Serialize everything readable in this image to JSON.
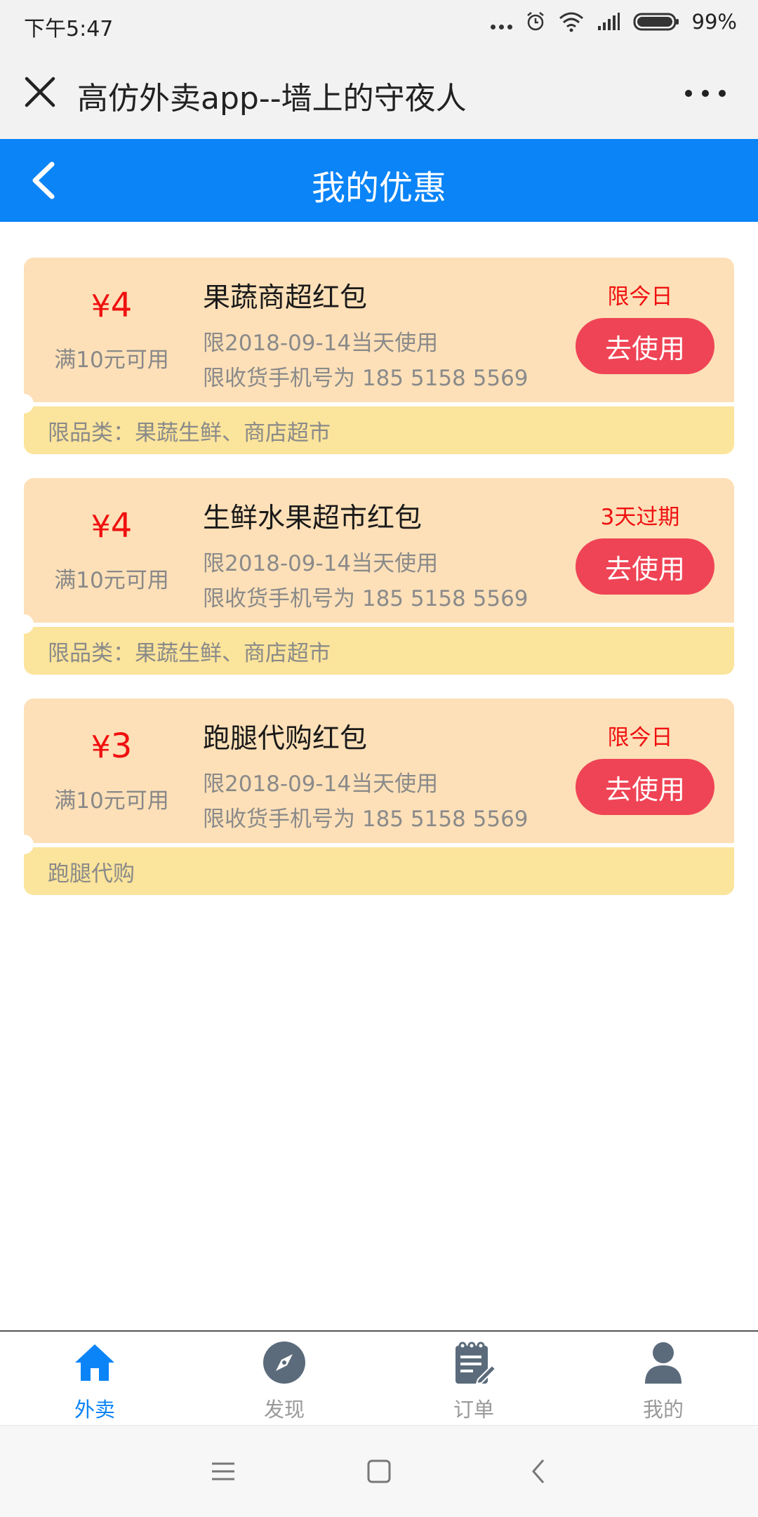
{
  "status_bar": {
    "time": "下午5:47",
    "battery": "99%"
  },
  "title_bar": {
    "title": "高仿外卖app--墙上的守夜人"
  },
  "header": {
    "title": "我的优惠"
  },
  "colors": {
    "header_blue": "#0a84f7",
    "coupon_top": "#fde0b8",
    "coupon_bottom": "#fbe49b",
    "accent_red": "#f01010",
    "button_red": "#ef4455"
  },
  "coupons": [
    {
      "currency": "¥",
      "amount": "4",
      "condition": "满10元可用",
      "name": "果蔬商超红包",
      "date_limit": "限2018-09-14当天使用",
      "phone_limit": "限收货手机号为 185 5158 5569",
      "expiry": "限今日",
      "button": "去使用",
      "category": "限品类：果蔬生鲜、商店超市"
    },
    {
      "currency": "¥",
      "amount": "4",
      "condition": "满10元可用",
      "name": "生鲜水果超市红包",
      "date_limit": "限2018-09-14当天使用",
      "phone_limit": "限收货手机号为 185 5158 5569",
      "expiry": "3天过期",
      "button": "去使用",
      "category": "限品类：果蔬生鲜、商店超市"
    },
    {
      "currency": "¥",
      "amount": "3",
      "condition": "满10元可用",
      "name": "跑腿代购红包",
      "date_limit": "限2018-09-14当天使用",
      "phone_limit": "限收货手机号为 185 5158 5569",
      "expiry": "限今日",
      "button": "去使用",
      "category": "跑腿代购"
    }
  ],
  "tabs": [
    {
      "label": "外卖",
      "icon": "home-icon",
      "active": true
    },
    {
      "label": "发现",
      "icon": "compass-icon",
      "active": false
    },
    {
      "label": "订单",
      "icon": "order-icon",
      "active": false
    },
    {
      "label": "我的",
      "icon": "user-icon",
      "active": false
    }
  ],
  "nav_buttons": [
    "menu-icon",
    "home-square-icon",
    "back-icon"
  ]
}
